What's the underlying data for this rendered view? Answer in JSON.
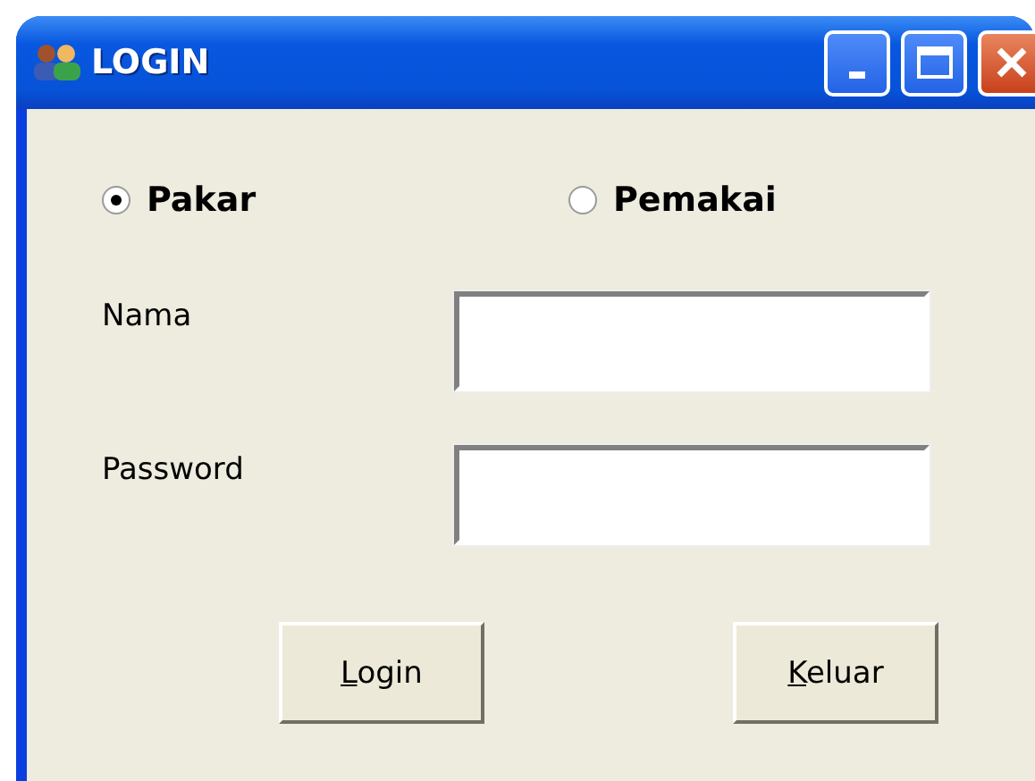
{
  "window": {
    "title": "LOGIN"
  },
  "roles": [
    {
      "label": "Pakar",
      "selected": true
    },
    {
      "label": "Pemakai",
      "selected": false
    }
  ],
  "fields": [
    {
      "label": "Nama"
    },
    {
      "label": "Password"
    }
  ],
  "buttons": [
    {
      "label": "Login",
      "mnemonic": true
    },
    {
      "label": "Keluar",
      "mnemonic": true
    }
  ]
}
